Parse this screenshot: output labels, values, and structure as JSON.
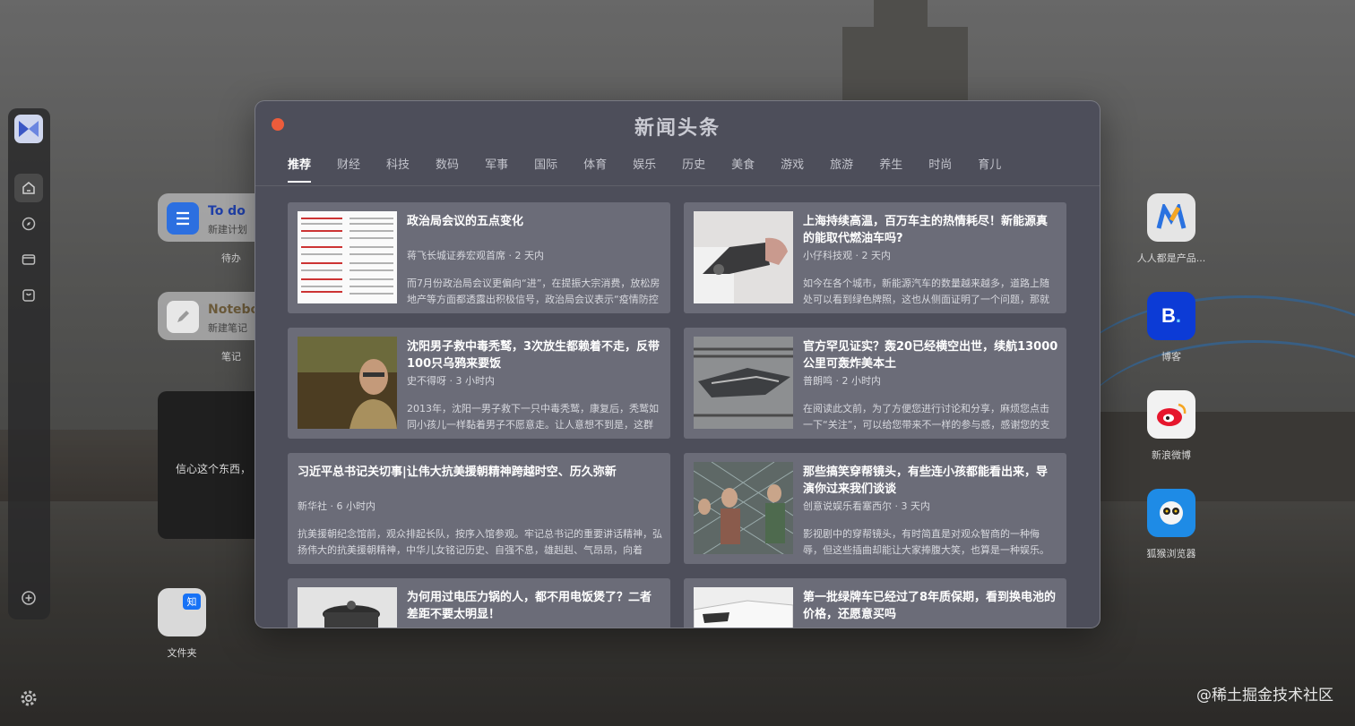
{
  "window": {
    "title": "新闻头条",
    "tabs": [
      "推荐",
      "财经",
      "科技",
      "数码",
      "军事",
      "国际",
      "体育",
      "娱乐",
      "历史",
      "美食",
      "游戏",
      "旅游",
      "养生",
      "时尚",
      "育儿"
    ],
    "active_tab": "推荐"
  },
  "news": [
    {
      "title": "政治局会议的五点变化",
      "meta": "蒋飞长城证券宏观首席 · 2 天内",
      "summary": "而7月份政治局会议更偏向“进”，在提振大宗消费，放松房地产等方面都透露出积极信号，政治局会议表示“疫情防控"
    },
    {
      "title": "上海持续高温，百万车主的热情耗尽！新能源真的能取代燃油车吗?",
      "meta": "小仔科技观 · 2 天内",
      "summary": "如今在各个城市，新能源汽车的数量越来越多，道路上随处可以看到绿色牌照，这也从侧面证明了一个问题，那就"
    },
    {
      "title": "沈阳男子救中毒秃鹫，3次放生都赖着不走，反带100只乌鸦来要饭",
      "meta": "史不得呀 · 3 小时内",
      "summary": "2013年，沈阳一男子救下一只中毒秃鹫，康复后，秃鹫如同小孩儿一样黏着男子不愿意走。让人意想不到是，这群"
    },
    {
      "title": "官方罕见证实？轰20已经横空出世，续航13000公里可轰炸美本土",
      "meta": "普朗鸣 · 2 小时内",
      "summary": "在阅读此文前，为了方便您进行讨论和分享，麻烦您点击一下“关注”，可以给您带来不一样的参与感，感谢您的支"
    },
    {
      "title": "习近平总书记关切事|让伟大抗美援朝精神跨越时空、历久弥新",
      "meta": "新华社 · 6 小时内",
      "summary": "抗美援朝纪念馆前，观众排起长队，按序入馆参观。牢记总书记的重要讲话精神，弘扬伟大的抗美援朝精神，中华儿女铭记历史、自强不息，雄赳赳、气昂昂，向着"
    },
    {
      "title": "那些搞笑穿帮镜头，有些连小孩都能看出来，导演你过来我们谈谈",
      "meta": "创意说娱乐看塞西尔 · 3 天内",
      "summary": "影视剧中的穿帮镜头，有时简直是对观众智商的一种侮辱，但这些插曲却能让大家捧腹大笑，也算是一种娱乐。"
    },
    {
      "title": "为何用过电压力锅的人，都不用电饭煲了？二者差距不要太明显！",
      "meta": "",
      "summary": ""
    },
    {
      "title": "第一批绿牌车已经过了8年质保期，看到换电池的价格，还愿意买吗",
      "meta": "",
      "summary": ""
    }
  ],
  "desktop": {
    "todo_title": "To do",
    "todo_sub": "新建计划",
    "todo_label": "待办",
    "note_title": "Notebo",
    "note_sub": "新建笔记",
    "note_label": "笔记",
    "quote_text": "信心这个东西，",
    "folder_label": "文件夹",
    "folder_badge": "知",
    "apps": [
      "人人都是产品...",
      "博客",
      "新浪微博",
      "狐猴浏览器"
    ],
    "watermark": "@稀土掘金技术社区"
  },
  "colors": {
    "accent": "#ec5c3b",
    "window_bg": "#4d4e5a",
    "card_bg": "#6b6c78"
  }
}
